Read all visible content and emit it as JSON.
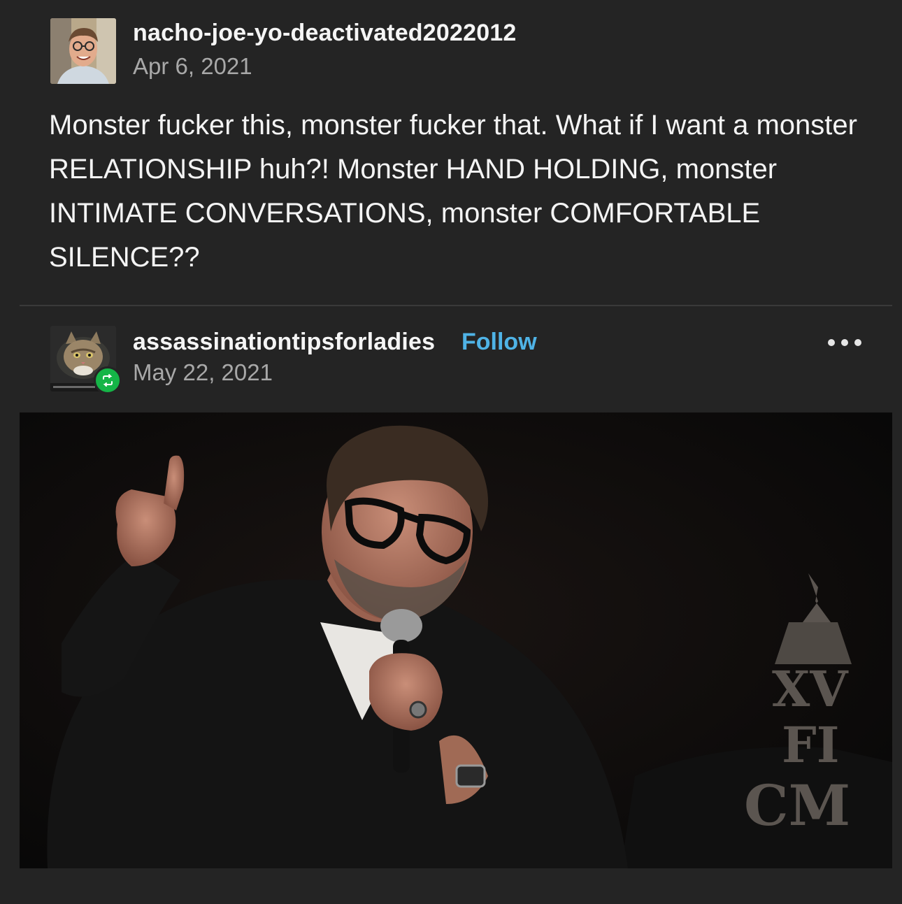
{
  "post": {
    "author": {
      "username": "nacho-joe-yo-deactivated2022012",
      "date": "Apr 6, 2021",
      "avatar_icon": "person-avatar"
    },
    "text": "Monster fucker this, monster fucker that. What if I want a monster RELATIONSHIP huh?! Monster HAND HOLDING, monster INTIMATE CONVERSATIONS, monster COMFORTABLE SILENCE??"
  },
  "reblog": {
    "username": "assassinationtipsforladies",
    "follow_label": "Follow",
    "date": "May 22, 2021",
    "avatar_icon": "cat-avatar",
    "badge_icon": "reblog-icon",
    "more_icon": "more-options-icon"
  },
  "photo": {
    "icon": "man-with-microphone-photo",
    "logo_lines": [
      "XV",
      "FI",
      "CM"
    ]
  },
  "colors": {
    "background": "#242424",
    "follow": "#4fb3e6",
    "reblog_badge": "#15b547"
  }
}
